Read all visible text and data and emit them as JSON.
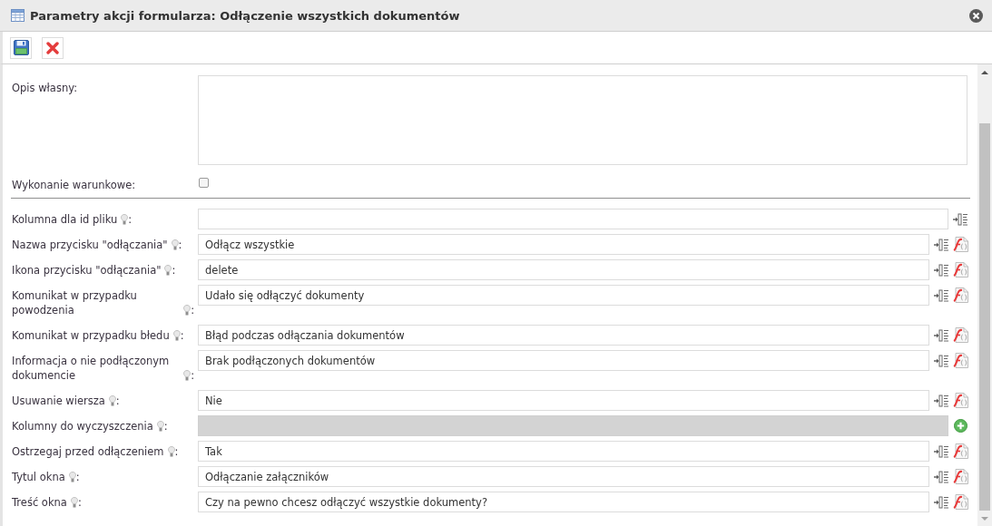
{
  "window": {
    "title": "Parametry akcji formularza: Odłączenie wszystkich dokumentów"
  },
  "form": {
    "description": {
      "label": "Opis własny:"
    },
    "conditional": {
      "label": "Wykonanie warunkowe:",
      "checked": false
    },
    "fields": [
      {
        "kind": "column",
        "label": "Kolumna dla id pliku",
        "suffix": ":"
      },
      {
        "kind": "text",
        "label": "Nazwa przycisku \"odłączania\"",
        "suffix": ":",
        "value": "Odłącz wszystkie"
      },
      {
        "kind": "text",
        "label": "Ikona przycisku \"odłączania\"",
        "suffix": ":",
        "value": "delete"
      },
      {
        "kind": "text",
        "label": "Komunikat w przypadku powodzenia",
        "suffix": ":",
        "value": "Udało się odłączyć dokumenty"
      },
      {
        "kind": "text",
        "label": "Komunikat w przypadku błedu",
        "suffix": ":",
        "value": "Błąd podczas odłączania dokumentów"
      },
      {
        "kind": "text",
        "label": "Informacja o nie podłączonym dokumencie",
        "suffix": ":",
        "value": "Brak podłączonych dokumentów"
      },
      {
        "kind": "text",
        "label": "Usuwanie wiersza",
        "suffix": ":",
        "value": "Nie"
      },
      {
        "kind": "list",
        "label": "Kolumny do wyczyszczenia",
        "suffix": ":"
      },
      {
        "kind": "text",
        "label": "Ostrzegaj przed odłączeniem",
        "suffix": ":",
        "value": "Tak"
      },
      {
        "kind": "text",
        "label": "Tytul okna",
        "suffix": ":",
        "value": "Odłączanie załączników"
      },
      {
        "kind": "text",
        "label": "Treść okna",
        "suffix": ":",
        "value": "Czy na pewno chcesz odłączyć wszystkie dokumenty?"
      }
    ]
  }
}
